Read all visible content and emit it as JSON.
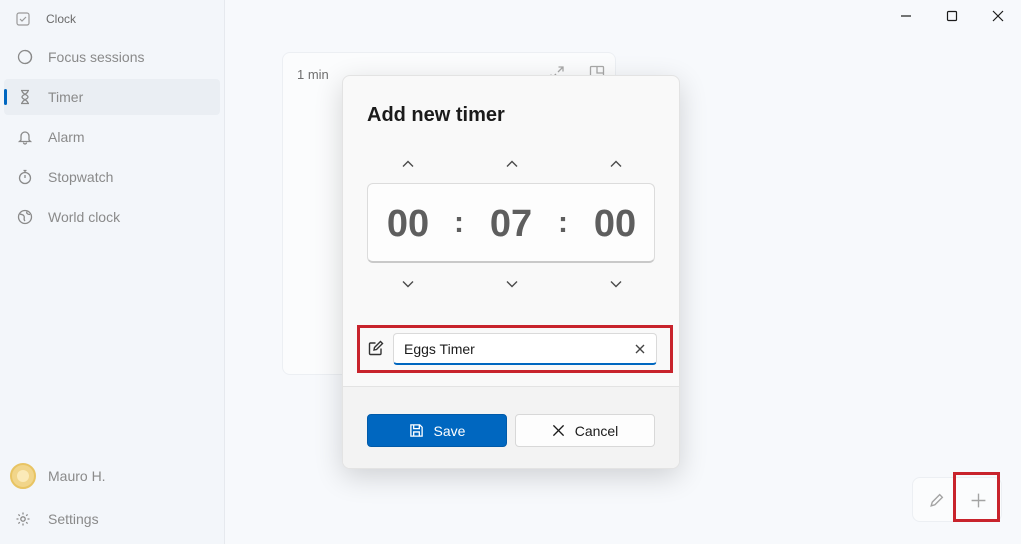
{
  "app": {
    "title": "Clock"
  },
  "sidebar": {
    "items": [
      {
        "label": "Focus sessions",
        "icon": "focus-icon"
      },
      {
        "label": "Timer",
        "icon": "hourglass-icon",
        "active": true
      },
      {
        "label": "Alarm",
        "icon": "bell-icon"
      },
      {
        "label": "Stopwatch",
        "icon": "stopwatch-icon"
      },
      {
        "label": "World clock",
        "icon": "globe-icon"
      }
    ],
    "user": {
      "name": "Mauro H."
    },
    "settings_label": "Settings"
  },
  "timer_card": {
    "duration_label": "1 min"
  },
  "dialog": {
    "title": "Add new timer",
    "hours": "00",
    "minutes": "07",
    "seconds": "00",
    "separator": ":",
    "name_value": "Eggs Timer",
    "save_label": "Save",
    "cancel_label": "Cancel"
  },
  "colors": {
    "accent": "#0067c0",
    "highlight": "#c8232c"
  }
}
